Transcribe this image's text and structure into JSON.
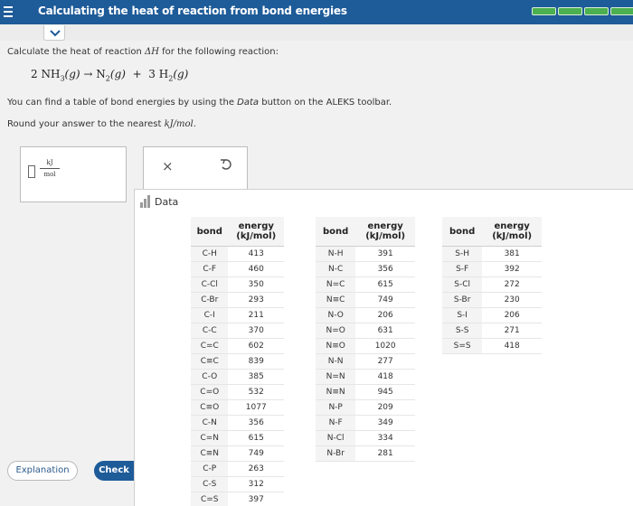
{
  "header": {
    "title": "Calculating the heat of reaction from bond energies",
    "progress_segments": 4,
    "accent": "#1e5b99",
    "progress_color": "#4caf50"
  },
  "question": {
    "prompt_before": "Calculate the heat of reaction ",
    "prompt_math": "ΔH",
    "prompt_after": " for the following reaction:",
    "reaction": {
      "coef1": "2",
      "reactant": "NH",
      "reactant_sub": "3",
      "reactant_state": "(g)",
      "arrow": "→",
      "product1": "N",
      "product1_sub": "2",
      "product1_state": "(g)",
      "plus": "+",
      "coef2": "3",
      "product2": "H",
      "product2_sub": "2",
      "product2_state": "(g)"
    },
    "note_before": "You can find a table of bond energies by using the ",
    "note_italic": "Data",
    "note_after": " button on the ALEKS toolbar.",
    "round_before": "Round your answer to the nearest ",
    "round_unit": "kJ/mol",
    "round_after": "."
  },
  "answer": {
    "value": "",
    "unit_numerator": "kJ",
    "unit_denominator": "mol"
  },
  "tools": {
    "clear_icon": "x-icon",
    "undo_icon": "undo-icon"
  },
  "data_panel": {
    "label": "Data",
    "col_bond": "bond",
    "col_energy_line1": "energy",
    "col_energy_line2": "(kJ/mol)",
    "table1": [
      [
        "C-H",
        "413"
      ],
      [
        "C-F",
        "460"
      ],
      [
        "C-Cl",
        "350"
      ],
      [
        "C-Br",
        "293"
      ],
      [
        "C-I",
        "211"
      ],
      [
        "C-C",
        "370"
      ],
      [
        "C=C",
        "602"
      ],
      [
        "C≡C",
        "839"
      ],
      [
        "C-O",
        "385"
      ],
      [
        "C=O",
        "532"
      ],
      [
        "C≡O",
        "1077"
      ],
      [
        "C-N",
        "356"
      ],
      [
        "C=N",
        "615"
      ],
      [
        "C≡N",
        "749"
      ],
      [
        "C-P",
        "263"
      ],
      [
        "C-S",
        "312"
      ],
      [
        "C=S",
        "397"
      ]
    ],
    "table2": [
      [
        "N-H",
        "391"
      ],
      [
        "N-C",
        "356"
      ],
      [
        "N=C",
        "615"
      ],
      [
        "N≡C",
        "749"
      ],
      [
        "N-O",
        "206"
      ],
      [
        "N=O",
        "631"
      ],
      [
        "N≡O",
        "1020"
      ],
      [
        "N-N",
        "277"
      ],
      [
        "N=N",
        "418"
      ],
      [
        "N≡N",
        "945"
      ],
      [
        "N-P",
        "209"
      ],
      [
        "N-F",
        "349"
      ],
      [
        "N-Cl",
        "334"
      ],
      [
        "N-Br",
        "281"
      ]
    ],
    "table3": [
      [
        "S-H",
        "381"
      ],
      [
        "S-F",
        "392"
      ],
      [
        "S-Cl",
        "272"
      ],
      [
        "S-Br",
        "230"
      ],
      [
        "S-I",
        "206"
      ],
      [
        "S-S",
        "271"
      ],
      [
        "S=S",
        "418"
      ]
    ]
  },
  "buttons": {
    "explanation": "Explanation",
    "check": "Check"
  }
}
